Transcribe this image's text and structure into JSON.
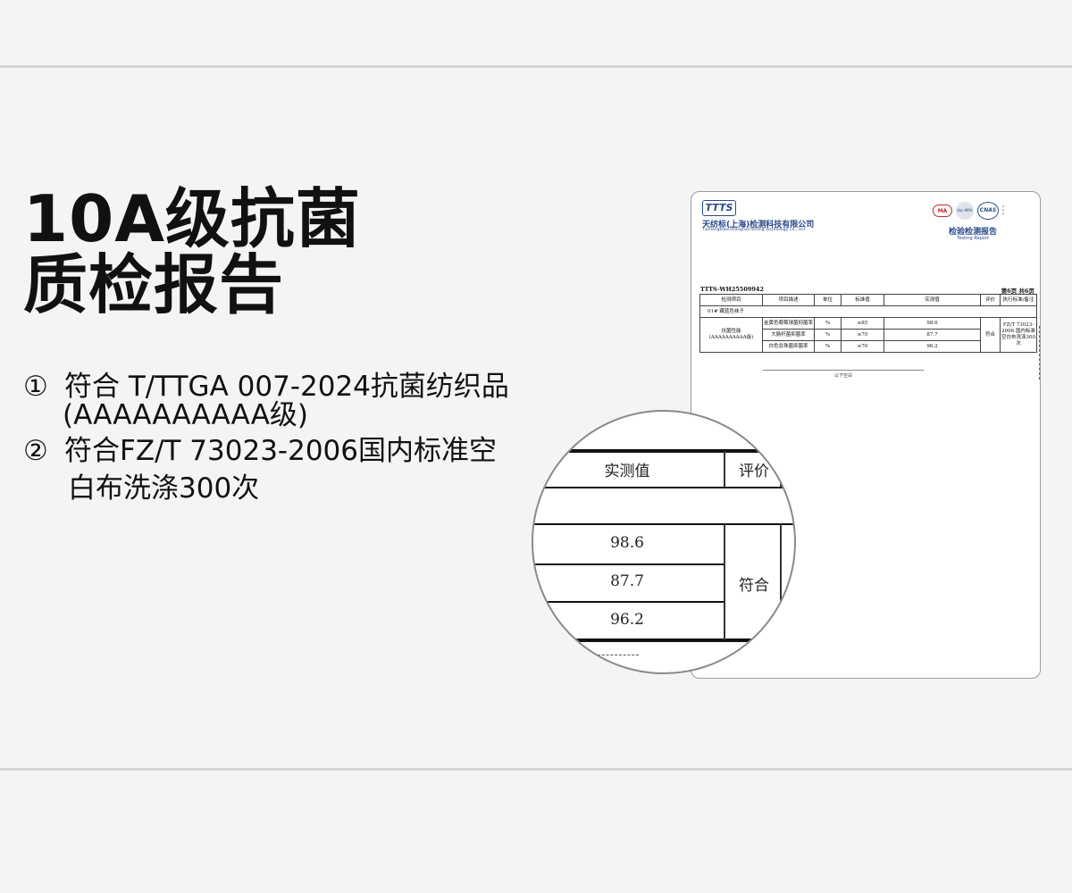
{
  "heading": {
    "line1": "10A级抗菌",
    "line2": "质检报告"
  },
  "bullets": [
    {
      "num": "①",
      "text": "符合 T/TTGA 007-2024抗菌纺织品",
      "cont": "(AAAAAAAAAA级)"
    },
    {
      "num": "②",
      "text": "符合FZ/T 73023-2006国内标准空",
      "cont": "白布洗涤300次"
    }
  ],
  "report": {
    "logo": "TTTS",
    "company": "天纺标(上海)检测科技有限公司",
    "company_en": "Tianfangbiao(Shanghai)Testing Technology Co., Ltd.",
    "certs": [
      "MA",
      "ilac-MRA",
      "CNAS"
    ],
    "title": "检验检测报告",
    "title_en": "Testing Report",
    "report_no": "TTTS-WH25509942",
    "page_info": "第6页 共6页",
    "headers": [
      "检测项目",
      "项目描述",
      "单位",
      "标准值",
      "实测值",
      "评价",
      "执行标准/备注"
    ],
    "sample": "01#  藏蓝色袜子",
    "item": "抗菌性能\n(AAAAAAAAAA级)",
    "rows": [
      {
        "desc": "金黄色葡萄球菌抑菌率",
        "unit": "%",
        "std": "≥85",
        "val": "98.6"
      },
      {
        "desc": "大肠杆菌抑菌率",
        "unit": "%",
        "std": "≥70",
        "val": "87.7"
      },
      {
        "desc": "白色念珠菌抑菌率",
        "unit": "%",
        "std": "≥70",
        "val": "96.2"
      }
    ],
    "evaluation": "符合",
    "standard": "FZ/T 73023-2006 国内标准空白布洗涤300次",
    "end_note": "以下空白"
  },
  "magnifier": {
    "col_value": "实测值",
    "col_eval": "评价",
    "values": [
      "98.6",
      "87.7",
      "96.2"
    ],
    "evaluation": "符合"
  }
}
